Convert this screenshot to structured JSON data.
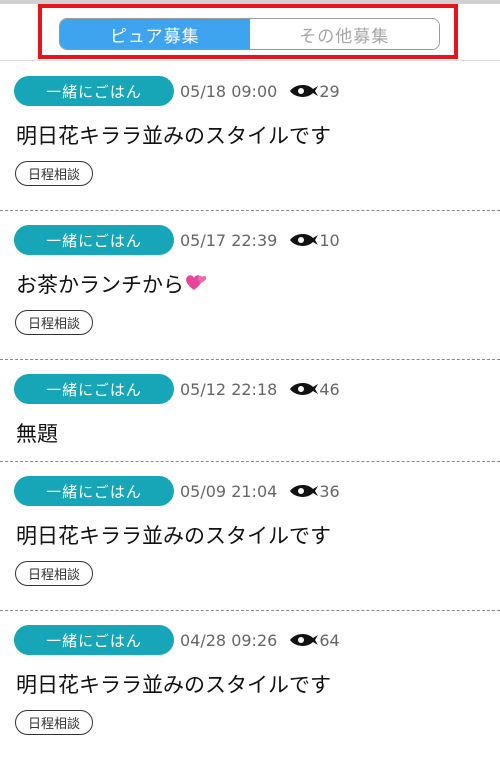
{
  "tabs": [
    {
      "label": "ピュア募集",
      "active": true
    },
    {
      "label": "その他募集",
      "active": false
    }
  ],
  "colors": {
    "accent": "#3fa4f0",
    "badge": "#17a6b8",
    "highlight": "#e8141c"
  },
  "posts": [
    {
      "category": "一緒にごはん",
      "datetime": "05/18 09:00",
      "views": "29",
      "title": "明日花キララ並みのスタイルです",
      "tag": "日程相談"
    },
    {
      "category": "一緒にごはん",
      "datetime": "05/17 22:39",
      "views": "10",
      "title": "お茶かランチから",
      "emoji": "heart-icon",
      "tag": "日程相談"
    },
    {
      "category": "一緒にごはん",
      "datetime": "05/12 22:18",
      "views": "46",
      "title": "無題"
    },
    {
      "category": "一緒にごはん",
      "datetime": "05/09 21:04",
      "views": "36",
      "title": "明日花キララ並みのスタイルです",
      "tag": "日程相談"
    },
    {
      "category": "一緒にごはん",
      "datetime": "04/28 09:26",
      "views": "64",
      "title": "明日花キララ並みのスタイルです",
      "tag": "日程相談"
    }
  ]
}
